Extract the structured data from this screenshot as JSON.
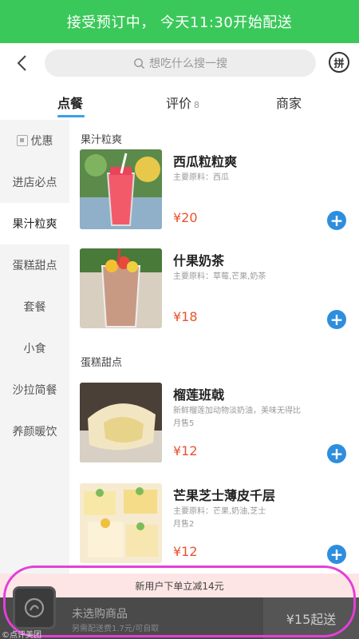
{
  "banner": {
    "text": "接受预订中， 今天11:30开始配送"
  },
  "topbar": {
    "back_icon": "chevron-left-icon",
    "search_placeholder": "想吃什么搜一搜",
    "pin_label": "拼"
  },
  "tabs": [
    {
      "label": "点餐",
      "count": ""
    },
    {
      "label": "评价",
      "count": "8"
    },
    {
      "label": "商家",
      "count": ""
    }
  ],
  "sidebar": {
    "items": [
      {
        "label": "优惠"
      },
      {
        "label": "进店必点"
      },
      {
        "label": "果汁粒爽"
      },
      {
        "label": "蛋糕甜点"
      },
      {
        "label": "套餐"
      },
      {
        "label": "小食"
      },
      {
        "label": "沙拉简餐"
      },
      {
        "label": "养颜暖饮"
      }
    ],
    "active": "果汁粒爽"
  },
  "sections": [
    {
      "title": "果汁粒爽",
      "items": [
        {
          "name": "西瓜粒粒爽",
          "desc": "主要原料：西瓜",
          "sales": "",
          "price": "¥20"
        },
        {
          "name": "什果奶茶",
          "desc": "主要原料：草莓,芒果,奶茶",
          "sales": "",
          "price": "¥18"
        }
      ]
    },
    {
      "title": "蛋糕甜点",
      "items": [
        {
          "name": "榴莲班戟",
          "desc": "新鲜榴莲加动物淡奶油，美味无得比",
          "sales": "月售5",
          "price": "¥12"
        },
        {
          "name": "芒果芝士薄皮千层",
          "desc": "主要原料：芒果,奶油,芝士",
          "sales": "月售2",
          "price": "¥12"
        }
      ]
    }
  ],
  "cart": {
    "promo": "新用户下单立减14元",
    "empty_text": "未选购商品",
    "fee_text": "另需配送费1.7元/可自取",
    "checkout_label": "¥15起送"
  },
  "watermark": "©点评美团",
  "colors": {
    "banner": "#3ac85a",
    "accent": "#2e8ede",
    "price": "#e8522f"
  }
}
